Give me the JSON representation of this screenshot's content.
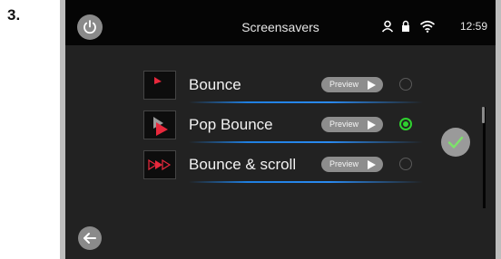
{
  "step_number": "3.",
  "header": {
    "title": "Screensavers",
    "time": "12:59",
    "icons": [
      "power-icon",
      "user-icon",
      "lock-icon",
      "wifi-icon"
    ]
  },
  "screensavers": [
    {
      "label": "Bounce",
      "preview_label": "Preview",
      "selected": false
    },
    {
      "label": "Pop Bounce",
      "preview_label": "Preview",
      "selected": true
    },
    {
      "label": "Bounce & scroll",
      "preview_label": "Preview",
      "selected": false
    }
  ],
  "controls": {
    "confirm_icon": "checkmark-icon",
    "back_icon": "back-arrow-icon"
  },
  "colors": {
    "accent_blue": "#1f7fe0",
    "selected_green": "#2fd12f",
    "play_red": "#e8283c"
  }
}
